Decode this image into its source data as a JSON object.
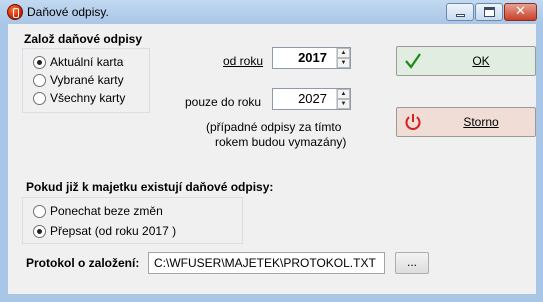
{
  "window": {
    "title": "Daňové odpisy.",
    "close_glyph": "✕"
  },
  "create_section": {
    "heading": "Založ daňové odpisy",
    "options": [
      "Aktuální karta",
      "Vybrané karty",
      "Všechny karty"
    ],
    "selected_index": 0
  },
  "from_year": {
    "label": "od roku",
    "value": "2017"
  },
  "only_to_year": {
    "label": "pouze do roku",
    "value": "2027",
    "note_line1": "(případné odpisy za tímto",
    "note_line2": "rokem budou vymazány)"
  },
  "existing_section": {
    "heading": "Pokud již k majetku existují daňové odpisy:",
    "options": [
      "Ponechat beze změn",
      "Přepsat (od roku 2017 )"
    ],
    "selected_index": 1
  },
  "protocol": {
    "label": "Protokol o založení:",
    "path": "C:\\WFUSER\\MAJETEK\\PROTOKOL.TXT",
    "browse_label": "..."
  },
  "buttons": {
    "ok_label": "OK",
    "cancel_label": "Storno"
  },
  "icons": {
    "ok": "checkmark-icon",
    "cancel": "power-icon",
    "ok_color": "#1a8a1a",
    "cancel_color": "#d42020"
  }
}
